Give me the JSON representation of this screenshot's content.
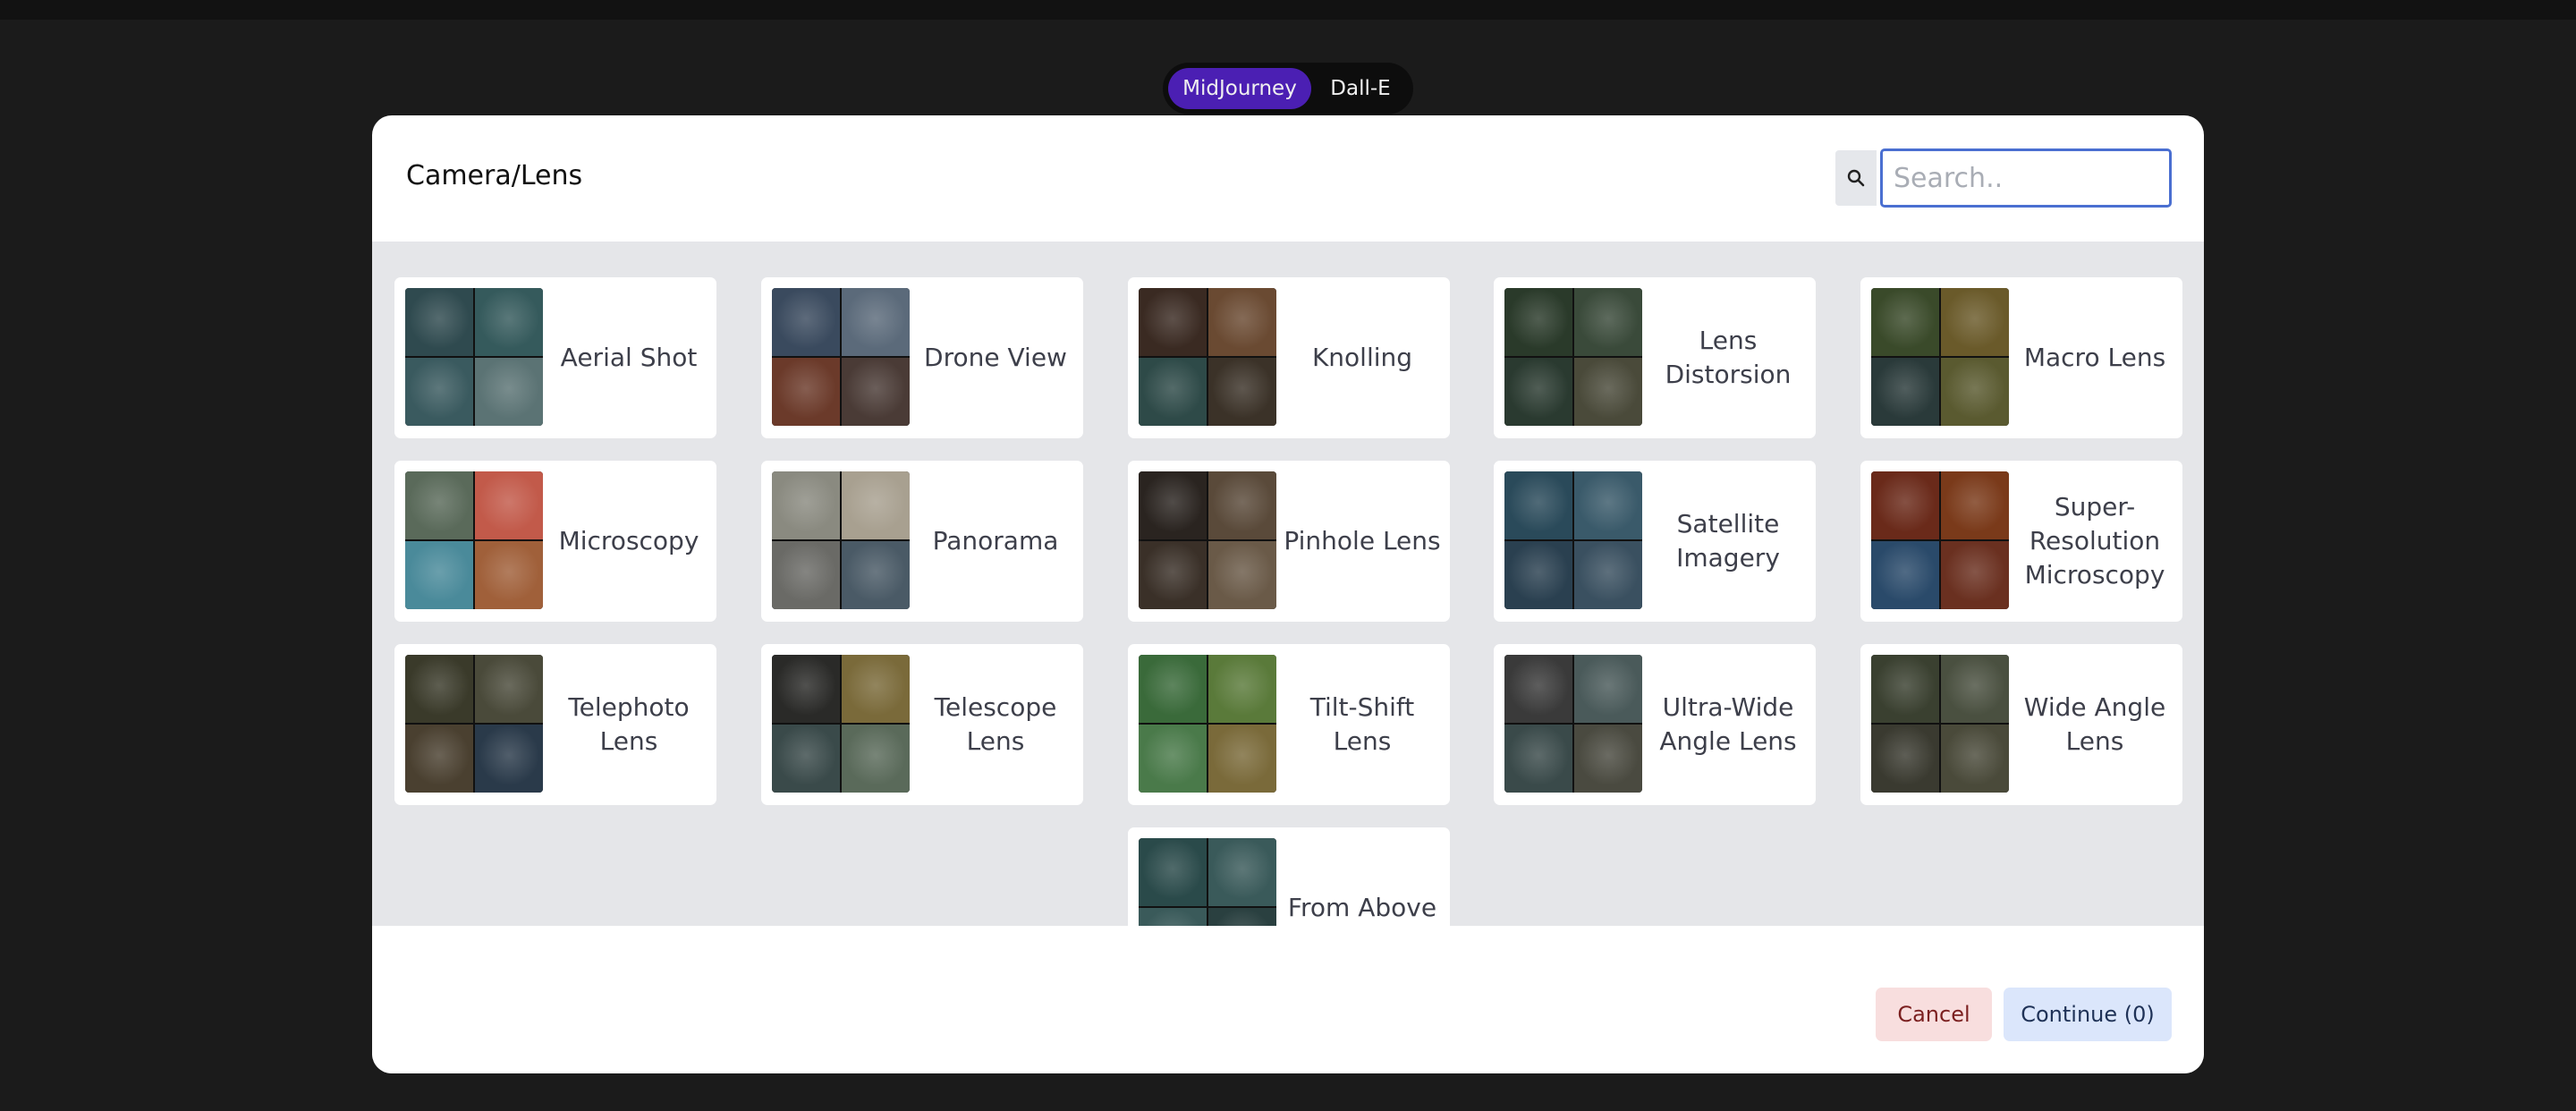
{
  "toggle": {
    "options": [
      "MidJourney",
      "Dall-E"
    ],
    "active": "MidJourney",
    "active_color": "#4b1fb3"
  },
  "modal": {
    "title": "Camera/Lens",
    "search": {
      "placeholder": "Search..",
      "value": ""
    },
    "items": [
      {
        "label": "Aerial Shot",
        "thumb": [
          "#2f4a4f",
          "#355a5c",
          "#3a5a5f",
          "#5b7374"
        ]
      },
      {
        "label": "Drone View",
        "thumb": [
          "#3a4a5e",
          "#5b6a7a",
          "#6b3a2a",
          "#4a3b36"
        ]
      },
      {
        "label": "Knolling",
        "thumb": [
          "#3a2a22",
          "#6a4a32",
          "#2e4a48",
          "#3b3228"
        ]
      },
      {
        "label": "Lens Distorsion",
        "thumb": [
          "#2a3a2a",
          "#3a4a3a",
          "#2a3a30",
          "#4a4a3a"
        ]
      },
      {
        "label": "Macro Lens",
        "thumb": [
          "#3a4a2a",
          "#6a5a2a",
          "#2a3a3a",
          "#5a5a30"
        ]
      },
      {
        "label": "Microscopy",
        "thumb": [
          "#5a6a5a",
          "#c25a4a",
          "#4a8a9a",
          "#a0603a"
        ]
      },
      {
        "label": "Panorama",
        "thumb": [
          "#8a8a80",
          "#a8a090",
          "#6a6a66",
          "#4a5a66"
        ]
      },
      {
        "label": "Pinhole Lens",
        "thumb": [
          "#2a2420",
          "#5a4a3a",
          "#3a3028",
          "#6a5a48"
        ]
      },
      {
        "label": "Satellite Imagery",
        "thumb": [
          "#2a4a5a",
          "#3a5a6a",
          "#2a4050",
          "#3a5060"
        ]
      },
      {
        "label": "Super-Resolution Microscopy",
        "thumb": [
          "#6a2a1a",
          "#7a3a1a",
          "#2a4a6a",
          "#6a3020"
        ]
      },
      {
        "label": "Telephoto Lens",
        "thumb": [
          "#3a3a2a",
          "#4a4a3a",
          "#4a4030",
          "#2a3a4a"
        ]
      },
      {
        "label": "Telescope Lens",
        "thumb": [
          "#2a2a28",
          "#7a6a3a",
          "#3a4a4a",
          "#5a6a5a"
        ]
      },
      {
        "label": "Tilt-Shift Lens",
        "thumb": [
          "#3a6a3a",
          "#5a7a3a",
          "#4a7a4a",
          "#7a6a3a"
        ]
      },
      {
        "label": "Ultra-Wide Angle Lens",
        "thumb": [
          "#3a3a3a",
          "#4a5a5a",
          "#3a4a4a",
          "#4a4a40"
        ]
      },
      {
        "label": "Wide Angle Lens",
        "thumb": [
          "#3a4030",
          "#4a5040",
          "#3a3a30",
          "#4a4a3a"
        ]
      },
      {
        "label": "From Above",
        "thumb": [
          "#2a4a4a",
          "#3a5a5a",
          "#3a5a5a",
          "#2a4040"
        ]
      }
    ]
  },
  "footer": {
    "cancel_label": "Cancel",
    "continue_label": "Continue (0)"
  }
}
